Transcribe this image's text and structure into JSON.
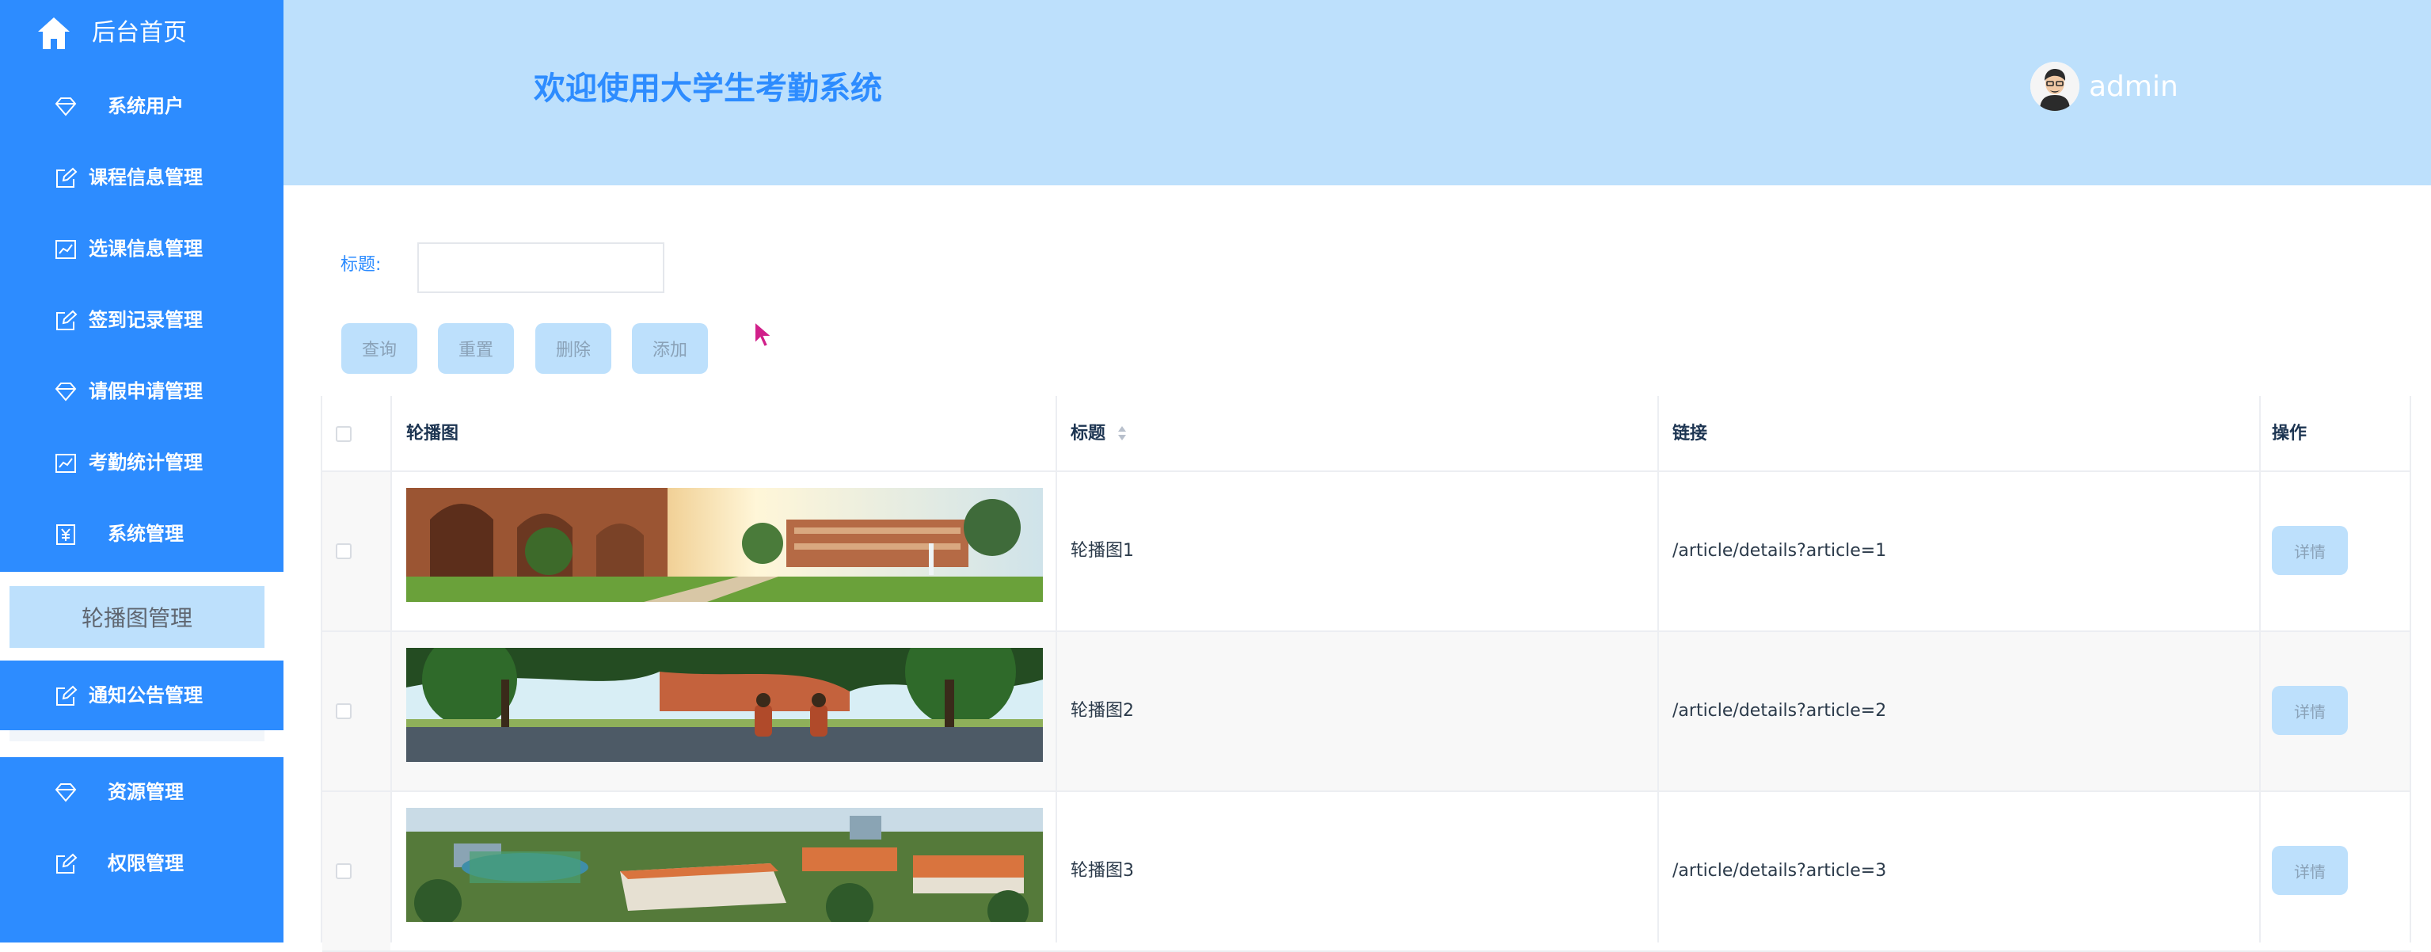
{
  "sidebar": {
    "home_label": "后台首页",
    "items": [
      {
        "label": "系统用户",
        "icon": "diamond-icon"
      },
      {
        "label": "课程信息管理",
        "icon": "edit-icon"
      },
      {
        "label": "选课信息管理",
        "icon": "chart-icon"
      },
      {
        "label": "签到记录管理",
        "icon": "edit-icon"
      },
      {
        "label": "请假申请管理",
        "icon": "diamond-icon"
      },
      {
        "label": "考勤统计管理",
        "icon": "chart-icon"
      },
      {
        "label": "系统管理",
        "icon": "yen-icon"
      }
    ],
    "active_item": "轮播图管理",
    "items_after": [
      {
        "label": "通知公告管理",
        "icon": "edit-icon"
      },
      {
        "label": "资源管理",
        "icon": "diamond-icon"
      },
      {
        "label": "权限管理",
        "icon": "edit-icon"
      }
    ]
  },
  "header": {
    "title": "欢迎使用大学生考勤系统",
    "username": "admin"
  },
  "search": {
    "label": "标题:",
    "value": "",
    "placeholder": ""
  },
  "buttons": {
    "query": "查询",
    "reset": "重置",
    "delete": "删除",
    "add": "添加"
  },
  "table": {
    "columns": [
      "轮播图",
      "标题",
      "链接",
      "操作"
    ],
    "rows": [
      {
        "title": "轮播图1",
        "link": "/article/details?article=1",
        "action": "详情",
        "image": "campus-courtyard-image"
      },
      {
        "title": "轮播图2",
        "link": "/article/details?article=2",
        "action": "详情",
        "image": "students-walking-image"
      },
      {
        "title": "轮播图3",
        "link": "/article/details?article=3",
        "action": "详情",
        "image": "campus-aerial-image"
      }
    ]
  },
  "colors": {
    "sidebar_bg": "#2d8cff",
    "header_bg": "#bde0fc",
    "accent": "#2d8cff",
    "button_bg": "#bde0fc"
  }
}
